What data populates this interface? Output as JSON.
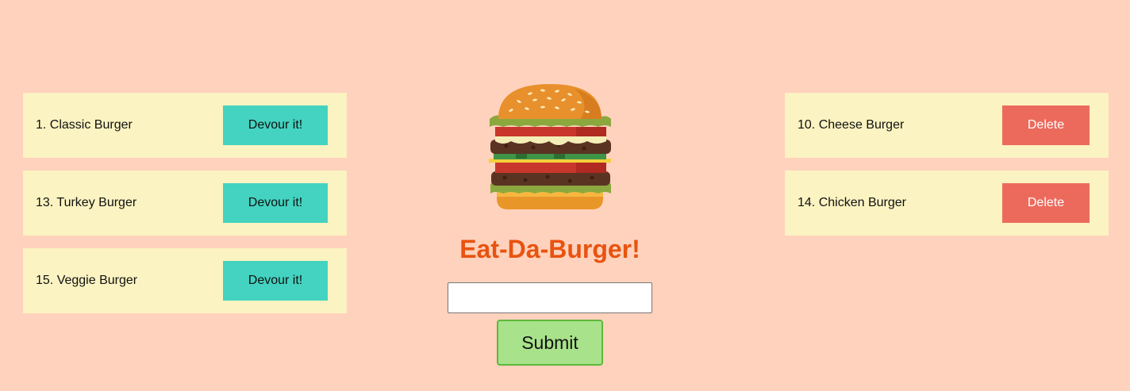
{
  "app": {
    "title": "Eat-Da-Burger!"
  },
  "colors": {
    "background": "#ffd2bd",
    "card": "#fbf3c1",
    "devour_button": "#43d3c0",
    "delete_button": "#ec6a5c",
    "title": "#e8530f",
    "submit_button": "#a8e28a"
  },
  "uneaten": {
    "items": [
      {
        "label": "1. Classic Burger",
        "button": "Devour it!"
      },
      {
        "label": "13. Turkey Burger",
        "button": "Devour it!"
      },
      {
        "label": "15. Veggie Burger",
        "button": "Devour it!"
      }
    ]
  },
  "devoured": {
    "items": [
      {
        "label": "10. Cheese Burger",
        "button": "Delete"
      },
      {
        "label": "14. Chicken Burger",
        "button": "Delete"
      }
    ]
  },
  "form": {
    "input_value": "",
    "input_placeholder": "",
    "submit_label": "Submit"
  },
  "icons": {
    "logo": "burger-icon"
  }
}
